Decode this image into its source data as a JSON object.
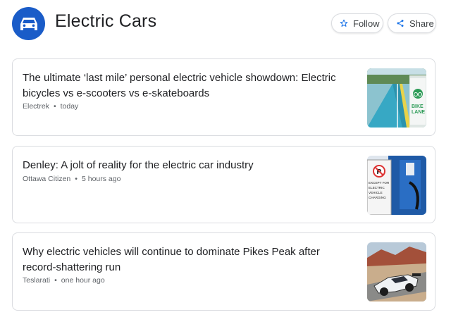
{
  "topic": {
    "title": "Electric Cars",
    "avatar_icon": "car-icon",
    "accent": "#1a5cc8"
  },
  "actions": {
    "follow_label": "Follow",
    "follow_icon": "star-outline-icon",
    "share_label": "Share",
    "share_icon": "share-icon"
  },
  "articles": [
    {
      "headline": "The ultimate ‘last mile’ personal electric vehicle showdown: Electric bicycles vs e-scooters vs e-skateboards",
      "source": "Electrek",
      "time": "today",
      "thumbnail_sign_text": "BIKE LANE"
    },
    {
      "headline": "Denley: A jolt of reality for the electric car industry",
      "source": "Ottawa Citizen",
      "time": "5 hours ago",
      "thumbnail_sign_text": "EXCEPT FOR ELECTRIC VEHICLE CHARGING"
    },
    {
      "headline": "Why electric vehicles will continue to dominate Pikes Peak after record-shattering run",
      "source": "Teslarati",
      "time": "one hour ago"
    }
  ]
}
